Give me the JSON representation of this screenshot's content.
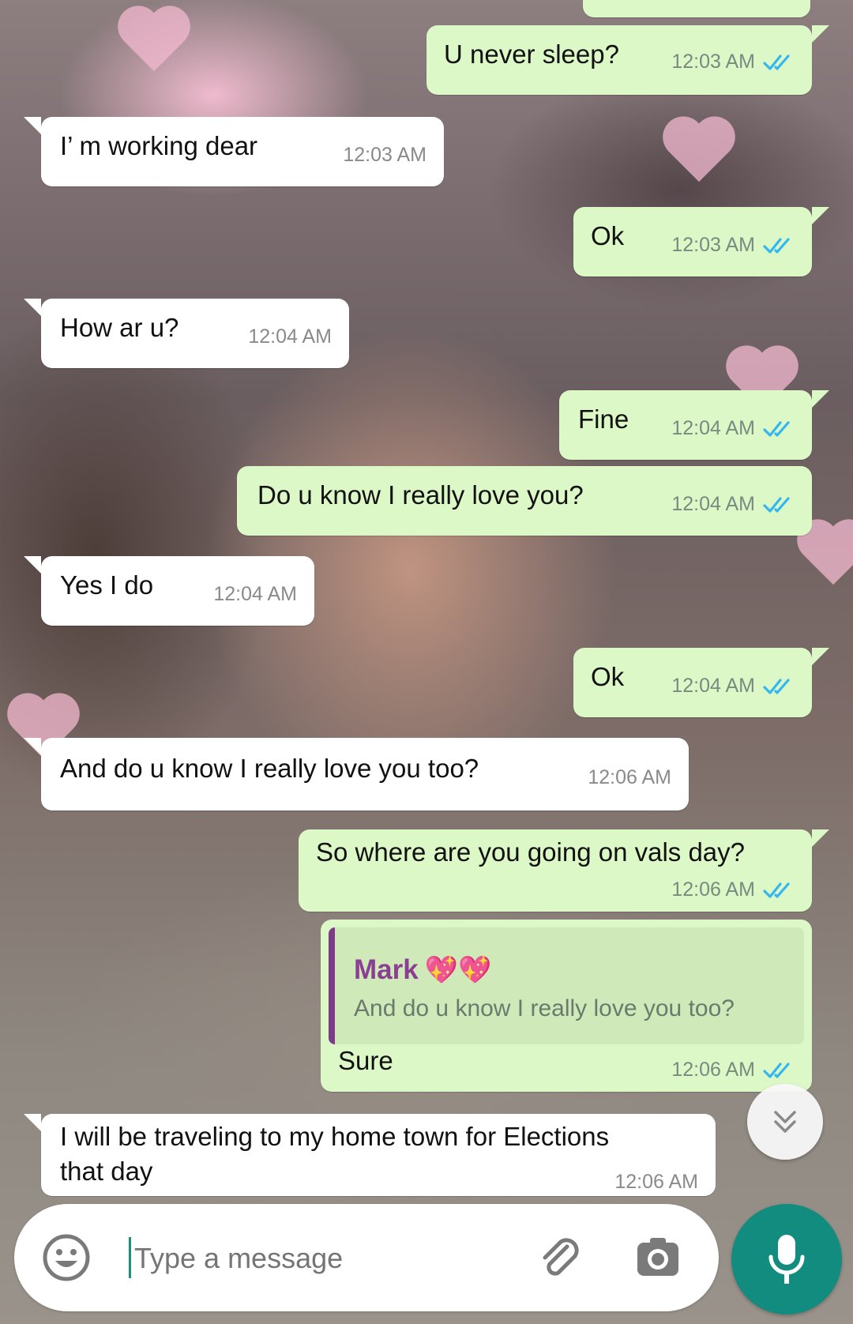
{
  "messages": [
    {
      "dir": "out",
      "text": "U never sleep?",
      "time": "12:03 AM"
    },
    {
      "dir": "in",
      "text": "I’ m working dear",
      "time": "12:03 AM"
    },
    {
      "dir": "out",
      "text": "Ok",
      "time": "12:03 AM"
    },
    {
      "dir": "in",
      "text": "How ar u?",
      "time": "12:04 AM"
    },
    {
      "dir": "out",
      "text": "Fine",
      "time": "12:04 AM"
    },
    {
      "dir": "out",
      "text": "Do u know I really love you?",
      "time": "12:04 AM"
    },
    {
      "dir": "in",
      "text": "Yes I do",
      "time": "12:04 AM"
    },
    {
      "dir": "out",
      "text": "Ok",
      "time": "12:04 AM"
    },
    {
      "dir": "in",
      "text": "And do u know I really love you too?",
      "time": "12:06 AM"
    },
    {
      "dir": "out",
      "text": "So where are you going on vals day?",
      "time": "12:06 AM"
    },
    {
      "dir": "out",
      "text": "Sure",
      "time": "12:06 AM",
      "reply_to": {
        "name": "Mark",
        "emoji": "💖💖",
        "text": "And do u know I really love you too?"
      }
    },
    {
      "dir": "in",
      "text_line1": "I will be traveling to my home town for Elections",
      "text_line2": "that day",
      "time": "12:06 AM"
    }
  ],
  "composer": {
    "placeholder": "Type a message"
  },
  "icons": {
    "read_receipt": "double-check-icon",
    "scroll_down": "chevron-double-down-icon",
    "emoji": "emoji-icon",
    "attach": "paperclip-icon",
    "camera": "camera-icon",
    "mic": "microphone-icon"
  },
  "colors": {
    "outgoing_bubble": "#dcf8c6",
    "incoming_bubble": "#ffffff",
    "read_tick": "#34b7f1",
    "accent": "#128c7e",
    "quote_name": "#8a3f95"
  }
}
